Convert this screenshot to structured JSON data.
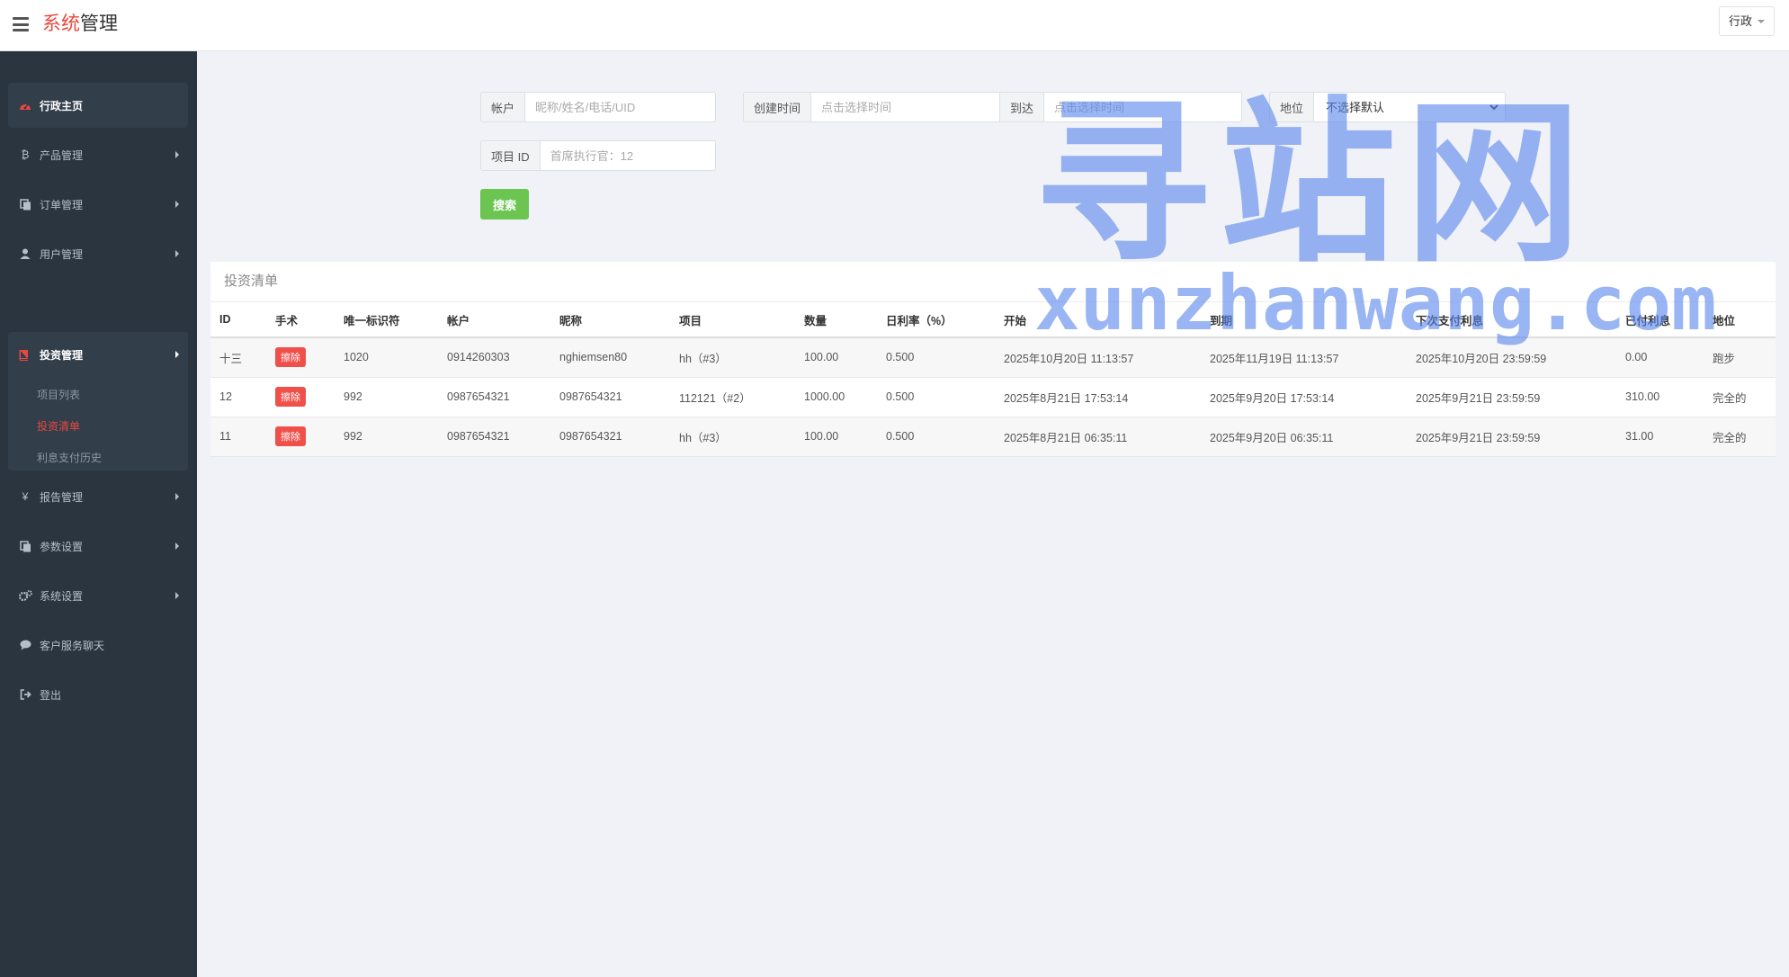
{
  "header": {
    "brand_part1": "系统",
    "brand_part2": "管理",
    "user_menu_label": "行政"
  },
  "sidebar": {
    "items": [
      {
        "label": "行政主页",
        "icon": "dashboard-icon"
      },
      {
        "label": "产品管理",
        "icon": "bitcoin-icon"
      },
      {
        "label": "订单管理",
        "icon": "copy-icon"
      },
      {
        "label": "用户管理",
        "icon": "user-icon"
      },
      {
        "label": "投资管理",
        "icon": "book-icon"
      },
      {
        "label": "报告管理",
        "icon": "yen-icon"
      },
      {
        "label": "参数设置",
        "icon": "copy-icon"
      },
      {
        "label": "系统设置",
        "icon": "gears-icon"
      },
      {
        "label": "客户服务聊天",
        "icon": "chat-icon"
      },
      {
        "label": "登出",
        "icon": "sign-out-icon"
      }
    ],
    "invest_sub": [
      "项目列表",
      "投资清单",
      "利息支付历史"
    ]
  },
  "search": {
    "account_label": "帐户",
    "account_placeholder": "昵称/姓名/电话/UID",
    "created_label": "创建时间",
    "created_placeholder": "点击选择时间",
    "to_label": "到达",
    "to_placeholder": "点击选择时间",
    "status_label": "地位",
    "status_selected": "不选择默认",
    "project_label": "项目 ID",
    "project_placeholder": "首席执行官：12",
    "search_button": "搜索"
  },
  "panel": {
    "title": "投资清单",
    "columns": [
      "ID",
      "手术",
      "唯一标识符",
      "帐户",
      "昵称",
      "项目",
      "数量",
      "日利率（%）",
      "开始",
      "到期",
      "下次支付利息",
      "已付利息",
      "地位"
    ],
    "delete_label": "擦除",
    "rows": [
      {
        "id": "十三",
        "uid": "1020",
        "account": "0914260303",
        "nickname": "nghiemsen80",
        "project": "hh（#3）",
        "amount": "100.00",
        "rate": "0.500",
        "start": "2025年10月20日 11:13:57",
        "expire": "2025年11月19日 11:13:57",
        "next_pay": "2025年10月20日 23:59:59",
        "paid": "0.00",
        "status": "跑步"
      },
      {
        "id": "12",
        "uid": "992",
        "account": "0987654321",
        "nickname": "0987654321",
        "project": "112121（#2）",
        "amount": "1000.00",
        "rate": "0.500",
        "start": "2025年8月21日 17:53:14",
        "expire": "2025年9月20日 17:53:14",
        "next_pay": "2025年9月21日 23:59:59",
        "paid": "310.00",
        "status": "完全的"
      },
      {
        "id": "11",
        "uid": "992",
        "account": "0987654321",
        "nickname": "0987654321",
        "project": "hh（#3）",
        "amount": "100.00",
        "rate": "0.500",
        "start": "2025年8月21日 06:35:11",
        "expire": "2025年9月20日 06:35:11",
        "next_pay": "2025年9月21日 23:59:59",
        "paid": "31.00",
        "status": "完全的"
      }
    ]
  },
  "watermark": {
    "line1": "寻站网",
    "line2": "xunzhanwang.com"
  }
}
